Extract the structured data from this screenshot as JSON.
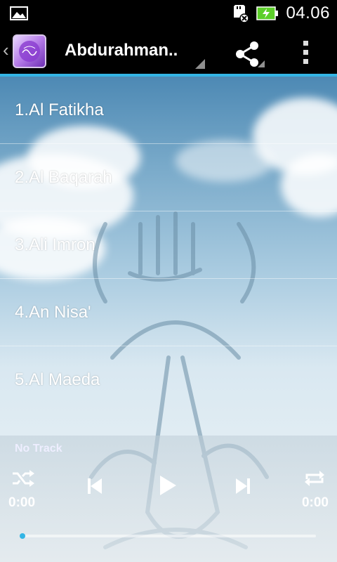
{
  "status_bar": {
    "time": "04.06"
  },
  "action_bar": {
    "title": "Abdurahman.."
  },
  "tracks": [
    {
      "label": "1.Al Fatikha"
    },
    {
      "label": "2.Al Baqarah"
    },
    {
      "label": "3.Ali Imron"
    },
    {
      "label": "4.An Nisa'"
    },
    {
      "label": "5.Al Maeda"
    }
  ],
  "player": {
    "now_playing": "No Track",
    "elapsed": "0:00",
    "duration": "0:00",
    "progress": 0.0
  },
  "icons": {
    "status_left": "image-icon",
    "sd_card": "sd-card-removed-icon",
    "battery": "battery-charging-icon",
    "share": "share-icon",
    "overflow": "overflow-menu-icon",
    "shuffle": "shuffle-icon",
    "previous": "skip-previous-icon",
    "play": "play-icon",
    "next": "skip-next-icon",
    "repeat": "repeat-icon"
  },
  "colors": {
    "accent": "#33b5e5",
    "bar": "#000000"
  }
}
